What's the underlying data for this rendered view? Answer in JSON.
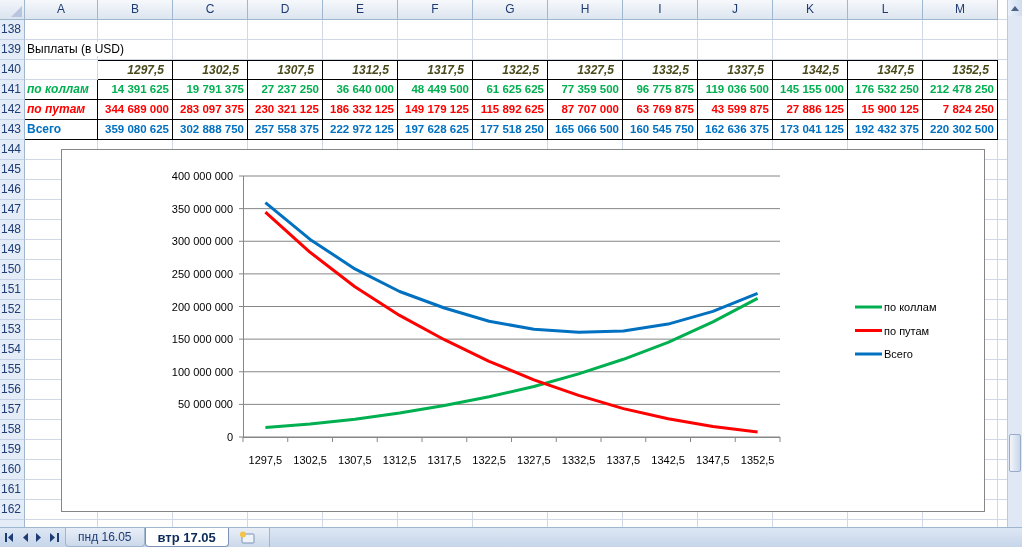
{
  "column_headers": [
    "A",
    "B",
    "C",
    "D",
    "E",
    "F",
    "G",
    "H",
    "I",
    "J",
    "K",
    "L",
    "M"
  ],
  "row_numbers": [
    "138",
    "139",
    "140",
    "141",
    "142",
    "143",
    "144",
    "145",
    "146",
    "147",
    "148",
    "149",
    "150",
    "151",
    "152",
    "153",
    "154",
    "155",
    "156",
    "157",
    "158",
    "159",
    "160",
    "161",
    "162"
  ],
  "title_cell": "Выплаты (в USD)",
  "table": {
    "header": [
      "1297,5",
      "1302,5",
      "1307,5",
      "1312,5",
      "1317,5",
      "1322,5",
      "1327,5",
      "1332,5",
      "1337,5",
      "1342,5",
      "1347,5",
      "1352,5"
    ],
    "rows": [
      {
        "label": "по коллам",
        "color": "#00b050",
        "values": [
          "14 391 625",
          "19 791 375",
          "27 237 250",
          "36 640 000",
          "48 449 500",
          "61 625 625",
          "77 359 500",
          "96 775 875",
          "119 036 500",
          "145 155 000",
          "176 532 250",
          "212 478 250"
        ]
      },
      {
        "label": "по путам",
        "color": "#ff0000",
        "values": [
          "344 689 000",
          "283 097 375",
          "230 321 125",
          "186 332 125",
          "149 179 125",
          "115 892 625",
          "87 707 000",
          "63 769 875",
          "43 599 875",
          "27 886 125",
          "15 900 125",
          "7 824 250"
        ]
      },
      {
        "label": "Всего",
        "color": "#0070c0",
        "values": [
          "359 080 625",
          "302 888 750",
          "257 558 375",
          "222 972 125",
          "197 628 625",
          "177 518 250",
          "165 066 500",
          "160 545 750",
          "162 636 375",
          "173 041 125",
          "192 432 375",
          "220 302 500"
        ]
      }
    ]
  },
  "chart_data": {
    "type": "line",
    "categories": [
      "1297,5",
      "1302,5",
      "1307,5",
      "1312,5",
      "1317,5",
      "1322,5",
      "1327,5",
      "1332,5",
      "1337,5",
      "1342,5",
      "1347,5",
      "1352,5"
    ],
    "ylim": [
      0,
      400000000
    ],
    "grid": true,
    "legend": true,
    "yticks": [
      {
        "value": 0,
        "label": "0"
      },
      {
        "value": 50000000,
        "label": "50 000 000"
      },
      {
        "value": 100000000,
        "label": "100 000 000"
      },
      {
        "value": 150000000,
        "label": "150 000 000"
      },
      {
        "value": 200000000,
        "label": "200 000 000"
      },
      {
        "value": 250000000,
        "label": "250 000 000"
      },
      {
        "value": 300000000,
        "label": "300 000 000"
      },
      {
        "value": 350000000,
        "label": "350 000 000"
      },
      {
        "value": 400000000,
        "label": "400 000 000"
      }
    ],
    "series": [
      {
        "name": "по коллам",
        "color": "#00b050",
        "values": [
          14391625,
          19791375,
          27237250,
          36640000,
          48449500,
          61625625,
          77359500,
          96775875,
          119036500,
          145155000,
          176532250,
          212478250
        ]
      },
      {
        "name": "по путам",
        "color": "#ff0000",
        "values": [
          344689000,
          283097375,
          230321125,
          186332125,
          149179125,
          115892625,
          87707000,
          63769875,
          43599875,
          27886125,
          15900125,
          7824250
        ]
      },
      {
        "name": "Всего",
        "color": "#0070c0",
        "values": [
          359080625,
          302888750,
          257558375,
          222972125,
          197628625,
          177518250,
          165066500,
          160545750,
          162636375,
          173041125,
          192432375,
          220302500
        ]
      }
    ]
  },
  "sheet_tabs": [
    {
      "label": "пнд 16.05",
      "selected": false
    },
    {
      "label": "втр 17.05",
      "selected": true
    }
  ]
}
